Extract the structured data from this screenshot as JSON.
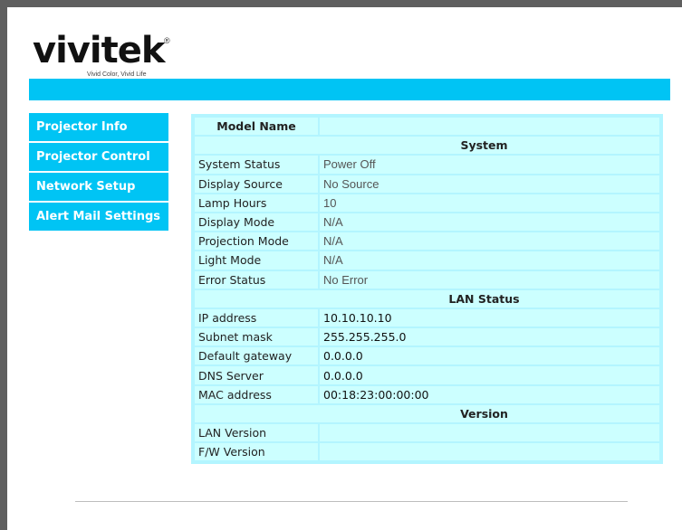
{
  "brand": {
    "name": "vivitek",
    "registered": "®",
    "tagline": "Vivid Color, Vivid Life"
  },
  "nav": {
    "items": [
      {
        "label": "Projector Info"
      },
      {
        "label": "Projector Control"
      },
      {
        "label": "Network Setup"
      },
      {
        "label": "Alert Mail Settings"
      }
    ]
  },
  "info": {
    "model_name_label": "Model Name",
    "model_name_value": "",
    "system": {
      "heading": "System",
      "rows": [
        {
          "label": "System Status",
          "value": "Power Off"
        },
        {
          "label": "Display Source",
          "value": "No Source"
        },
        {
          "label": "Lamp Hours",
          "value": "10"
        },
        {
          "label": "Display Mode",
          "value": "N/A"
        },
        {
          "label": "Projection Mode",
          "value": "N/A"
        },
        {
          "label": "Light Mode",
          "value": "N/A"
        },
        {
          "label": "Error Status",
          "value": "No Error"
        }
      ]
    },
    "lan": {
      "heading": "LAN Status",
      "rows": [
        {
          "label": "IP address",
          "value": "10.10.10.10"
        },
        {
          "label": "Subnet mask",
          "value": "255.255.255.0"
        },
        {
          "label": "Default gateway",
          "value": "0.0.0.0"
        },
        {
          "label": "DNS Server",
          "value": "0.0.0.0"
        },
        {
          "label": "MAC address",
          "value": "00:18:23:00:00:00"
        }
      ]
    },
    "version": {
      "heading": "Version",
      "rows": [
        {
          "label": "LAN Version",
          "value": ""
        },
        {
          "label": "F/W Version",
          "value": ""
        }
      ]
    }
  },
  "colors": {
    "accent": "#00c4f4",
    "table_bg": "#ccffff",
    "table_border": "#b3f5ff"
  }
}
